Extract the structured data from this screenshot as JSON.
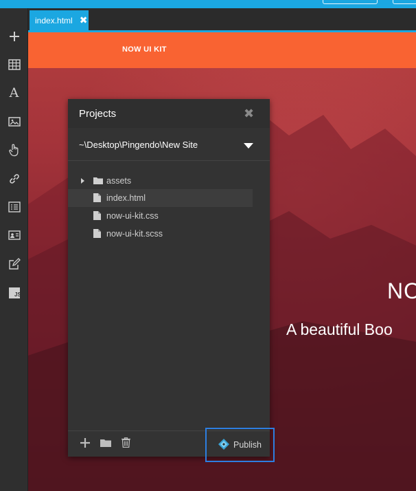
{
  "tab": {
    "filename": "index.html",
    "close_glyph": "✖"
  },
  "navbar": {
    "brand": "NOW UI KIT"
  },
  "hero": {
    "title": "NO",
    "subtitle": "A beautiful Boo"
  },
  "projects_panel": {
    "title": "Projects",
    "close_glyph": "✖",
    "path": "~\\Desktop\\Pingendo\\New Site",
    "files": [
      {
        "name": "assets",
        "type": "folder",
        "icon": "folder-icon"
      },
      {
        "name": "index.html",
        "type": "file",
        "icon": "file-icon",
        "selected": true
      },
      {
        "name": "now-ui-kit.css",
        "type": "file",
        "icon": "file-icon"
      },
      {
        "name": "now-ui-kit.scss",
        "type": "file",
        "icon": "file-icon"
      }
    ],
    "publish_label": "Publish"
  },
  "toolbar_icons": [
    "plus-icon",
    "table-icon",
    "text-icon",
    "image-icon",
    "hand-pointer-icon",
    "link-icon",
    "list-icon",
    "contact-card-icon",
    "edit-icon",
    "js-icon"
  ],
  "colors": {
    "accent_blue": "#1ba7e1",
    "navbar_orange": "#f96332",
    "publish_highlight": "#2d7ee0"
  }
}
